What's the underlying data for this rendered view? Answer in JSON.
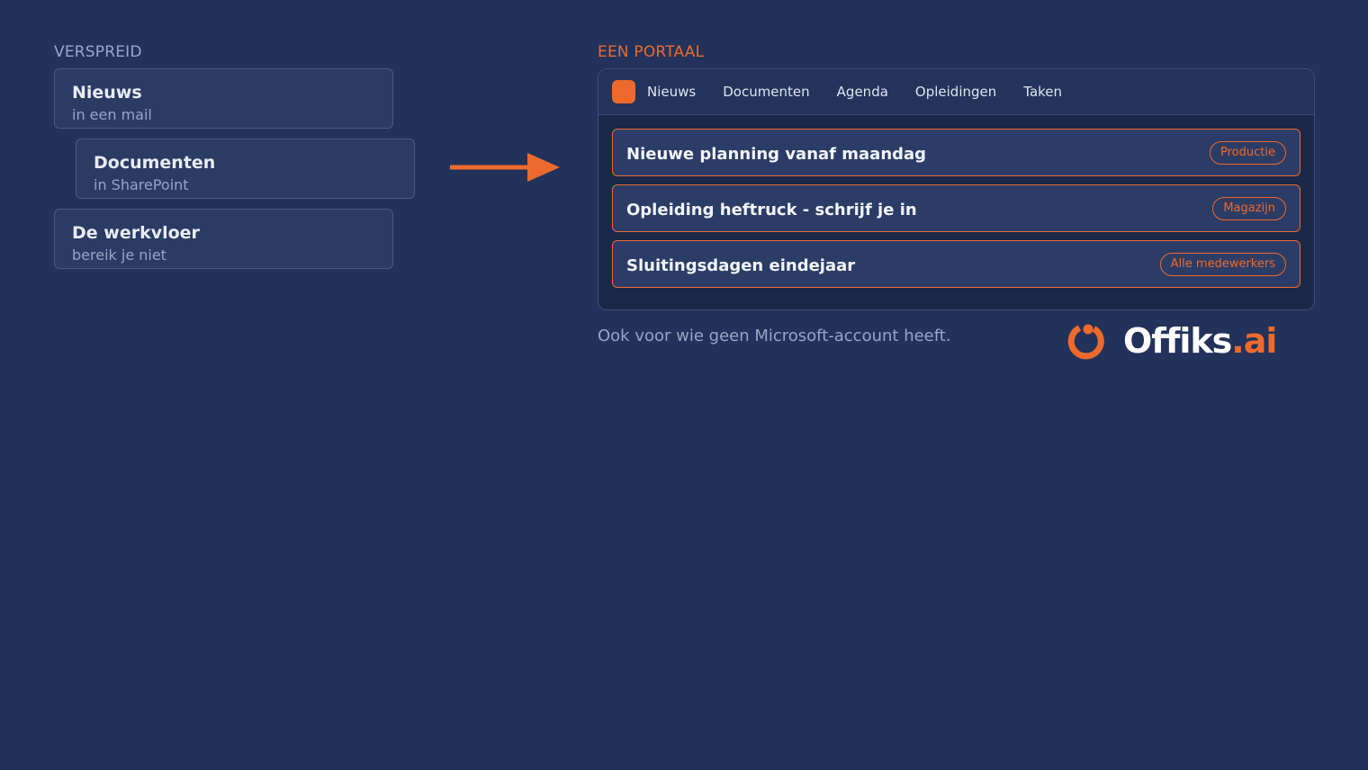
{
  "left": {
    "label": "VERSPREID",
    "cards": [
      {
        "title": "Nieuws",
        "subtitle": "in een mail"
      },
      {
        "title": "Documenten",
        "subtitle": "in SharePoint"
      },
      {
        "title": "De werkvloer",
        "subtitle": "bereik je niet"
      }
    ]
  },
  "right": {
    "label": "EEN PORTAAL",
    "nav": [
      "Nieuws",
      "Documenten",
      "Agenda",
      "Opleidingen",
      "Taken"
    ],
    "posts": [
      {
        "title": "Nieuwe planning vanaf maandag",
        "tag": "Productie"
      },
      {
        "title": "Opleiding heftruck - schrijf je in",
        "tag": "Magazijn"
      },
      {
        "title": "Sluitingsdagen eindejaar",
        "tag": "Alle medewerkers"
      }
    ],
    "footnote": "Ook voor wie geen Microsoft-account heeft."
  },
  "brand": {
    "name": "Offiks",
    "suffix": ".ai"
  },
  "colors": {
    "background": "#22325a",
    "accent": "#ee6a2c",
    "card": "#2a3b64"
  }
}
